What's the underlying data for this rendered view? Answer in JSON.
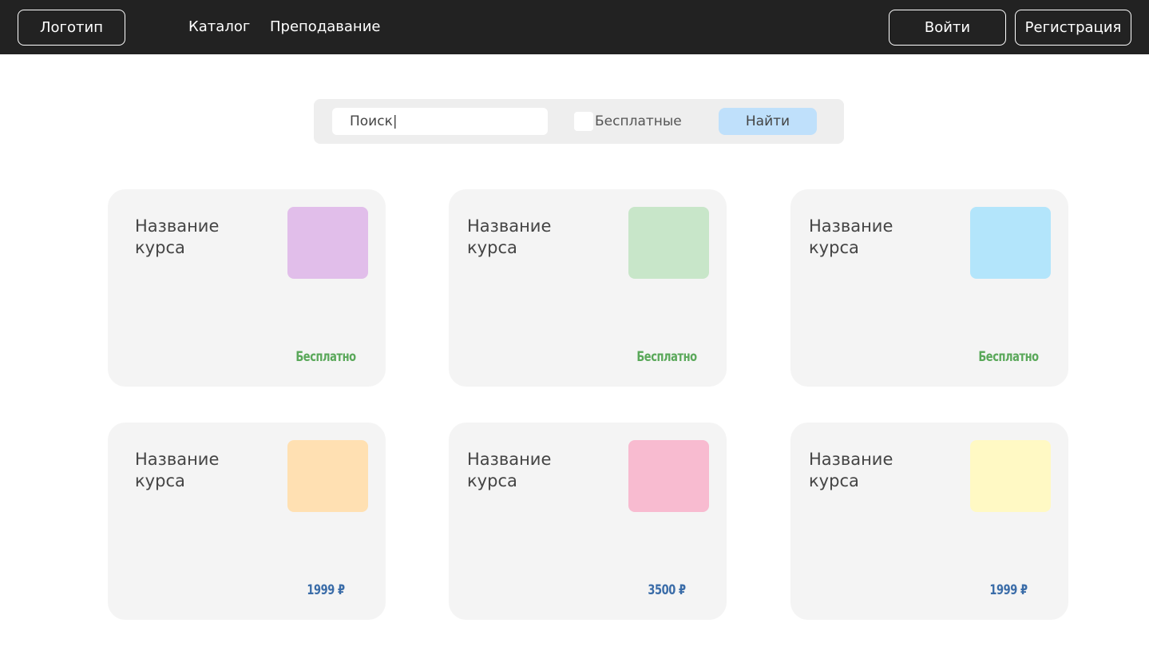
{
  "header": {
    "logo_label": "Логотип",
    "nav": [
      "Каталог",
      "Преподавание"
    ],
    "login_label": "Войти",
    "register_label": "Регистрация"
  },
  "search": {
    "value": "Поиск|",
    "free_label": "Бесплатные",
    "find_label": "Найти",
    "free_checked": false
  },
  "colors": {
    "header_bg": "#222222",
    "find_button": "#bfe0fb",
    "price_free": "#5aa85a",
    "price_paid": "#3a6ca8"
  },
  "courses": [
    {
      "title": "Название курса",
      "price": "Бесплатно",
      "free": true,
      "thumb_color": "#e1beea"
    },
    {
      "title": "Название курса",
      "price": "Бесплатно",
      "free": true,
      "thumb_color": "#c8e6c9"
    },
    {
      "title": "Название курса",
      "price": "Бесплатно",
      "free": true,
      "thumb_color": "#b3e5fb"
    },
    {
      "title": "Название курса",
      "price": "1999 ₽",
      "free": false,
      "thumb_color": "#ffe0b2"
    },
    {
      "title": "Название курса",
      "price": "3500 ₽",
      "free": false,
      "thumb_color": "#f8bbd0"
    },
    {
      "title": "Название курса",
      "price": "1999 ₽",
      "free": false,
      "thumb_color": "#fff9c4"
    }
  ]
}
